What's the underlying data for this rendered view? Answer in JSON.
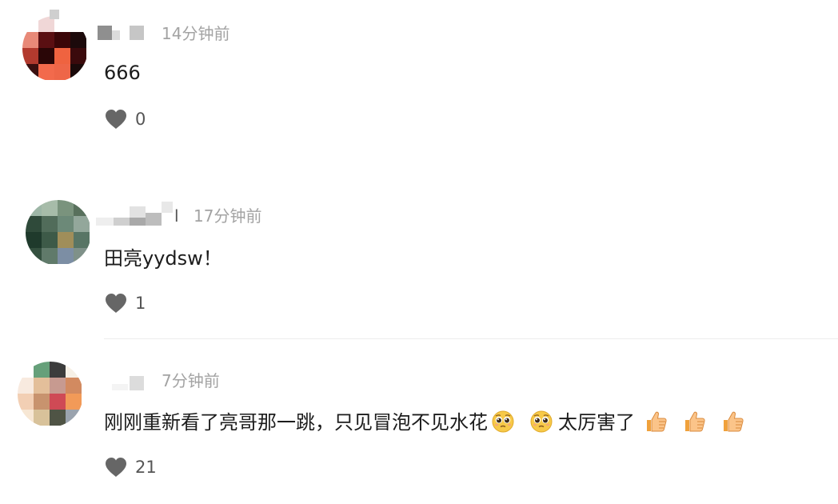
{
  "comments": [
    {
      "avatar": "avatar-pixelated-red",
      "time": "14分钟前",
      "text": "666",
      "likes": "0"
    },
    {
      "avatar": "avatar-pixelated-green",
      "name_fragment": "l",
      "time": "17分钟前",
      "text": "田亮yydsw！",
      "likes": "1"
    },
    {
      "avatar": "avatar-pixelated-multicolor",
      "time": "7分钟前",
      "text_part1": "刚刚重新看了亮哥那一跳，只见冒泡不见水花",
      "text_part2": "太厉害了",
      "emojis": [
        "pleading-face-emoji",
        "thumbs-up-emoji"
      ],
      "likes": "21"
    }
  ],
  "colors": {
    "time": "#a3a3a3",
    "heart": "#666666",
    "divider": "#ececec"
  },
  "icons": [
    "heart-icon"
  ]
}
